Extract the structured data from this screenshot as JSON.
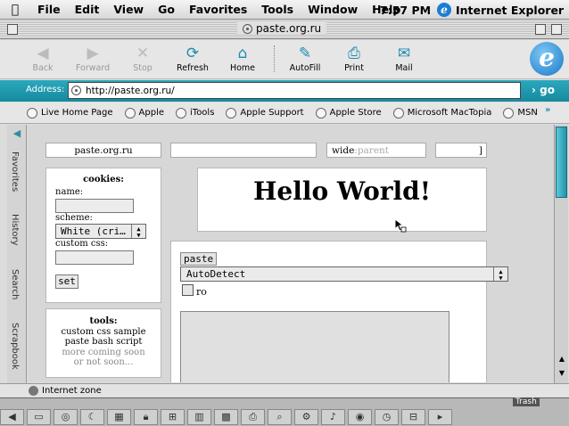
{
  "menubar": {
    "menus": [
      "File",
      "Edit",
      "View",
      "Go",
      "Favorites",
      "Tools",
      "Window",
      "Help"
    ],
    "clock": "7:57 PM",
    "app_name": "Internet Explorer"
  },
  "window": {
    "title": "paste.org.ru"
  },
  "toolbar": {
    "buttons": [
      {
        "label": "Back",
        "icon": "back-arrow-icon",
        "glyph": "◀",
        "enabled": false
      },
      {
        "label": "Forward",
        "icon": "forward-arrow-icon",
        "glyph": "▶",
        "enabled": false
      },
      {
        "label": "Stop",
        "icon": "stop-icon",
        "glyph": "✕",
        "enabled": false
      },
      {
        "label": "Refresh",
        "icon": "refresh-icon",
        "glyph": "⟳",
        "enabled": true
      },
      {
        "label": "Home",
        "icon": "home-icon",
        "glyph": "⌂",
        "enabled": true
      },
      {
        "label": "AutoFill",
        "icon": "autofill-icon",
        "glyph": "✎",
        "enabled": true
      },
      {
        "label": "Print",
        "icon": "print-icon",
        "glyph": "⎙",
        "enabled": true
      },
      {
        "label": "Mail",
        "icon": "mail-icon",
        "glyph": "✉",
        "enabled": true
      }
    ]
  },
  "address": {
    "label": "Address:",
    "url": "http://paste.org.ru/",
    "go_label": "go"
  },
  "favorites": [
    "Live Home Page",
    "Apple",
    "iTools",
    "Apple Support",
    "Apple Store",
    "Microsoft MacTopia",
    "MSN"
  ],
  "explorer_tabs": [
    "Favorites",
    "History",
    "Search",
    "Scrapbook"
  ],
  "page": {
    "top_bar": {
      "site_name": "paste.org.ru",
      "blank_field": "",
      "wide_label": "wide",
      "wide_sep": " : ",
      "parent_placeholder": "parent",
      "bracket": "]"
    },
    "cookies": {
      "title": "cookies:",
      "name_label": "name:",
      "name_value": "",
      "scheme_label": "scheme:",
      "scheme_value": "White (cri…",
      "css_label": "custom css:",
      "css_value": "",
      "set_label": "set"
    },
    "tools": {
      "title": "tools:",
      "links": [
        "custom css sample",
        "paste bash script"
      ],
      "note_line1": "more coming soon",
      "note_line2": "or not soon..."
    },
    "hello_heading": "Hello World!",
    "paste": {
      "legend": "paste",
      "syntax_value": "AutoDetect",
      "ro_label": "ro",
      "ro_checked": false,
      "text": ""
    }
  },
  "status": {
    "zone": "Internet zone"
  },
  "dock": {
    "trash_label": "Trash"
  },
  "colors": {
    "accent": "#1f8db0",
    "address_bar": "#1c97ab",
    "scroll_thumb": "#3fb3c7"
  }
}
